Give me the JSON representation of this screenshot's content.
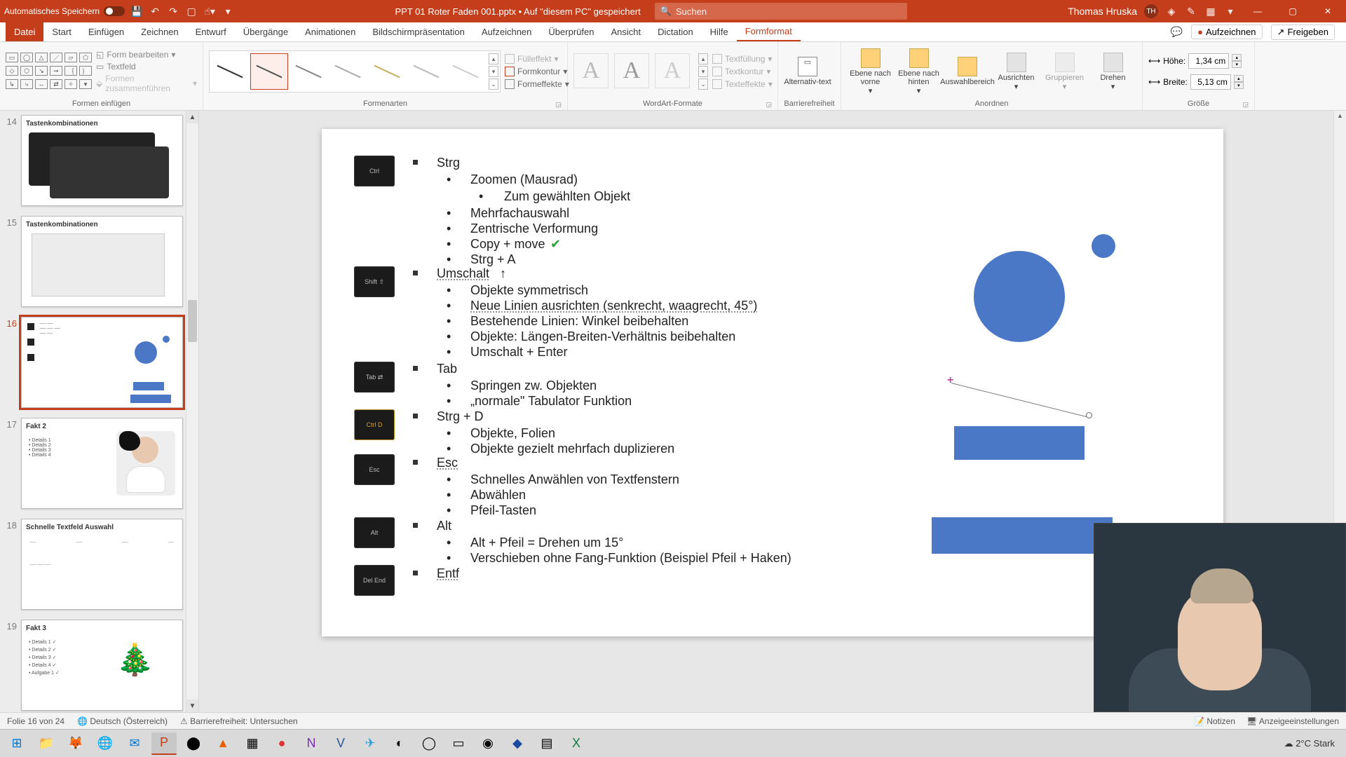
{
  "titlebar": {
    "autosave_label": "Automatisches Speichern",
    "doc_title": "PPT 01 Roter Faden 001.pptx • Auf \"diesem PC\" gespeichert",
    "search_placeholder": "Suchen",
    "user_name": "Thomas Hruska",
    "user_initials": "TH"
  },
  "menu": {
    "items": [
      "Datei",
      "Start",
      "Einfügen",
      "Zeichnen",
      "Entwurf",
      "Übergänge",
      "Animationen",
      "Bildschirmpräsentation",
      "Aufzeichnen",
      "Überprüfen",
      "Ansicht",
      "Dictation",
      "Hilfe",
      "Formformat"
    ],
    "active": "Formformat",
    "right_record": "Aufzeichnen",
    "right_share": "Freigeben"
  },
  "ribbon": {
    "insert_shapes": {
      "label": "Formen einfügen",
      "edit_shape": "Form bearbeiten",
      "textbox": "Textfeld",
      "merge": "Formen zusammenführen"
    },
    "shape_styles": {
      "label": "Formenarten"
    },
    "shape_fill": {
      "fill": "Fülleffekt",
      "outline": "Formkontur",
      "effects": "Formeffekte"
    },
    "wordart": {
      "label": "WordArt-Formate"
    },
    "text_fill": {
      "fill": "Textfüllung",
      "outline": "Textkontur",
      "effects": "Texteffekte"
    },
    "a11y": {
      "label": "Barrierefreiheit",
      "alt": "Alternativ-text"
    },
    "arrange": {
      "label": "Anordnen",
      "front": "Ebene nach vorne",
      "back": "Ebene nach hinten",
      "selpane": "Auswahlbereich",
      "align": "Ausrichten",
      "group": "Gruppieren",
      "rotate": "Drehen"
    },
    "size": {
      "label": "Größe",
      "height_label": "Höhe:",
      "height_value": "1,34 cm",
      "width_label": "Breite:",
      "width_value": "5,13 cm"
    }
  },
  "thumbs": [
    {
      "num": "14",
      "title": "Tastenkombinationen"
    },
    {
      "num": "15",
      "title": "Tastenkombinationen"
    },
    {
      "num": "16",
      "title": ""
    },
    {
      "num": "17",
      "title": "Fakt 2"
    },
    {
      "num": "18",
      "title": "Schnelle Textfeld Auswahl"
    },
    {
      "num": "19",
      "title": "Fakt 3"
    }
  ],
  "slide": {
    "sections": [
      {
        "head": "Strg",
        "items": [
          "Zoomen (Mausrad)",
          "Zum gewählten Objekt",
          "Mehrfachauswahl",
          "Zentrische Verformung",
          "Copy + move",
          "Strg + A"
        ]
      },
      {
        "head": "Umschalt ↑",
        "items": [
          "Objekte symmetrisch",
          "Neue Linien ausrichten (senkrecht, waagrecht, 45°)",
          "Bestehende Linien: Winkel beibehalten",
          "Objekte: Längen-Breiten-Verhältnis beibehalten",
          "Umschalt + Enter"
        ]
      },
      {
        "head": "Tab",
        "items": [
          "Springen zw. Objekten",
          "„normale\" Tabulator Funktion"
        ]
      },
      {
        "head": "Strg + D",
        "items": [
          "Objekte, Folien",
          "Objekte gezielt mehrfach duplizieren"
        ]
      },
      {
        "head": "Esc",
        "items": [
          "Schnelles Anwählen von Textfenstern",
          "Abwählen",
          "Pfeil-Tasten"
        ]
      },
      {
        "head": "Alt",
        "items": [
          "Alt + Pfeil = Drehen um 15°",
          "Verschieben ohne Fang-Funktion (Beispiel Pfeil + Haken)"
        ]
      },
      {
        "head": "Entf",
        "items": []
      }
    ]
  },
  "status": {
    "slide_info": "Folie 16 von 24",
    "language": "Deutsch (Österreich)",
    "a11y": "Barrierefreiheit: Untersuchen",
    "notes": "Notizen",
    "display": "Anzeigeeinstellungen"
  },
  "taskbar": {
    "weather_temp": "2°C",
    "weather_text": "Stark"
  }
}
